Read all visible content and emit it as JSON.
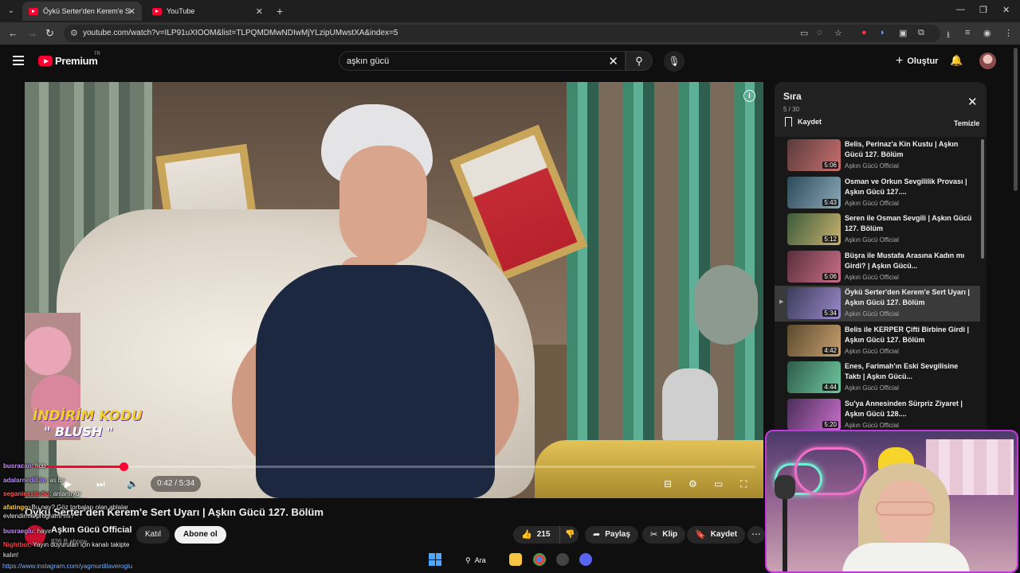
{
  "browser": {
    "tabs": [
      {
        "title": "Öykü Serter'den Kerem'e Sert U",
        "active": true
      },
      {
        "title": "YouTube",
        "active": false
      }
    ],
    "url": "youtube.com/watch?v=ILP91uXIOOM&list=TLPQMDMwNDIwMjYLzipUMwstXA&index=5"
  },
  "header": {
    "logo_text": "Premium",
    "country_code": "TR",
    "search_query": "aşkın gücü",
    "create_label": "Oluştur"
  },
  "video": {
    "promo_line1": "İNDİRİM KODU",
    "promo_line2": "\" BLUSH \"",
    "time_display": "0:42 / 5:34",
    "progress_fraction": 0.126,
    "title": "Öykü Serter'den Kerem'e Sert Uyarı | Aşkın Gücü 127. Bölüm",
    "channel_name": "Aşkın Gücü Official",
    "channel_subs": "826 B abone",
    "join_label": "Katıl",
    "subscribe_label": "Abone ol",
    "like_count": "215",
    "share_label": "Paylaş",
    "clip_label": "Klip",
    "save_label": "Kaydet"
  },
  "chat": {
    "messages": [
      {
        "user": "busracan",
        "text": ": hob"
      },
      {
        "user": "adalarnedilüle",
        "text": ": as bs"
      },
      {
        "user": "seganiesstudio",
        "text": ": anlamıyor"
      },
      {
        "user": "afatingo",
        "text": ": Bu ney? Göz torbaları olan ablalar"
      },
      {
        "user": "",
        "text": "evlendirme programı mı?"
      },
      {
        "user": "busraeglu",
        "text": ": hayır"
      },
      {
        "user": "Nightbot",
        "text": ": Yayın duyuruları için kanalı takipte"
      },
      {
        "user": "",
        "text": "kalın!"
      }
    ],
    "link": "https://www.instagram.com/yagmurdilaveroglu"
  },
  "playlist": {
    "title": "Sıra",
    "position": "5 / 30",
    "save_label": "Kaydet",
    "clear_label": "Temizle",
    "items": [
      {
        "title": "Belis, Perinaz'a Kin Kustu | Aşkın Gücü 127. Bölüm",
        "channel": "Aşkın Gücü Official",
        "duration": "5:06",
        "current": false
      },
      {
        "title": "Osman ve Orkun Sevgililik Provası | Aşkın Gücü 127....",
        "channel": "Aşkın Gücü Official",
        "duration": "5:43",
        "current": false
      },
      {
        "title": "Seren ile Osman Sevgili | Aşkın Gücü 127. Bölüm",
        "channel": "Aşkın Gücü Official",
        "duration": "5:12",
        "current": false
      },
      {
        "title": "Büşra ile Mustafa Arasına Kadın mı Girdi? | Aşkın Gücü...",
        "channel": "Aşkın Gücü Official",
        "duration": "5:06",
        "current": false
      },
      {
        "title": "Öykü Serter'den Kerem'e Sert Uyarı | Aşkın Gücü 127. Bölüm",
        "channel": "Aşkın Gücü Official",
        "duration": "5:34",
        "current": true
      },
      {
        "title": "Belis ile KERPER Çifti Birbine Girdi | Aşkın Gücü 127. Bölüm",
        "channel": "Aşkın Gücü Official",
        "duration": "4:42",
        "current": false
      },
      {
        "title": "Enes, Farimah'ın Eski Sevgilisine Taktı | Aşkın Gücü...",
        "channel": "Aşkın Gücü Official",
        "duration": "4:44",
        "current": false
      },
      {
        "title": "Su'ya Annesinden Sürpriz Ziyaret | Aşkın Gücü 128....",
        "channel": "Aşkın Gücü Official",
        "duration": "5:20",
        "current": false
      }
    ]
  },
  "taskbar": {
    "search_label": "Ara"
  },
  "colors": {
    "accent": "#ff0033",
    "stream_border": "#c23ad8"
  }
}
